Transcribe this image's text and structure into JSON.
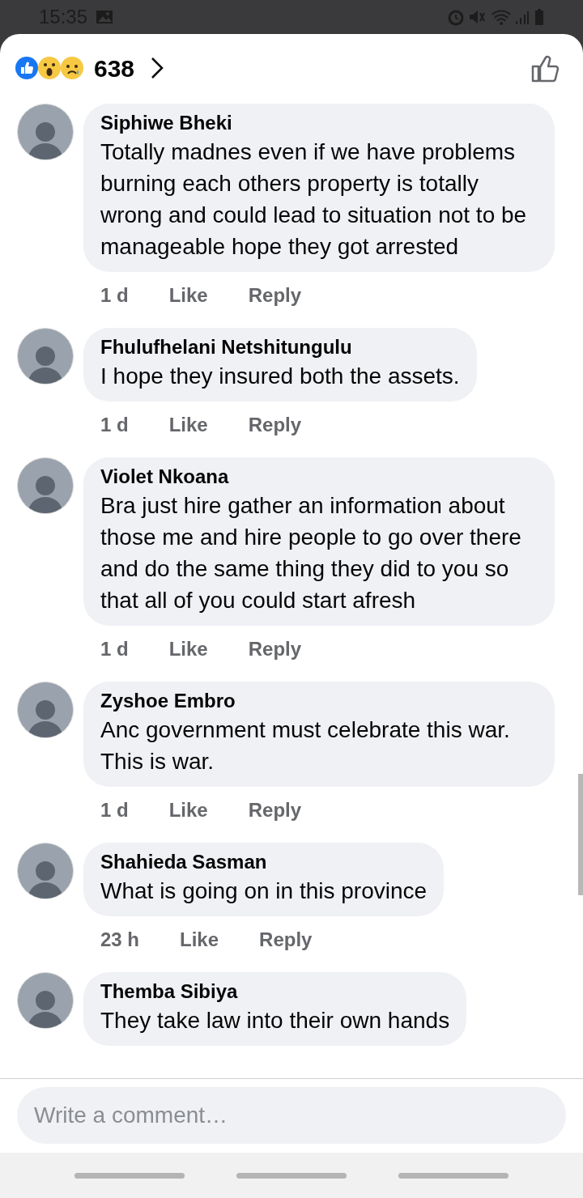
{
  "status_bar": {
    "time": "15:35"
  },
  "reactions": {
    "count": "638"
  },
  "comments": [
    {
      "name": "Siphiwe Bheki",
      "text": "Totally madnes even if we have problems burning each others property is totally wrong and could lead to situation not to be manageable hope they got arrested",
      "time": "1 d",
      "like": "Like",
      "reply": "Reply"
    },
    {
      "name": "Fhulufhelani Netshitungulu",
      "text": "I hope they insured both the assets.",
      "time": "1 d",
      "like": "Like",
      "reply": "Reply"
    },
    {
      "name": "Violet Nkoana",
      "text": "Bra just hire gather an information about those me and hire people to go over there and do the same thing they did to you so that all of you could start afresh",
      "time": "1 d",
      "like": "Like",
      "reply": "Reply"
    },
    {
      "name": "Zyshoe Embro",
      "text": "Anc government must celebrate this war. This is war.",
      "time": "1 d",
      "like": "Like",
      "reply": "Reply"
    },
    {
      "name": "Shahieda Sasman",
      "text": "What is going on in this province",
      "time": "23 h",
      "like": "Like",
      "reply": "Reply"
    },
    {
      "name": "Themba Sibiya",
      "text": "They take law into their own hands"
    }
  ],
  "composer": {
    "placeholder": "Write a comment…"
  }
}
